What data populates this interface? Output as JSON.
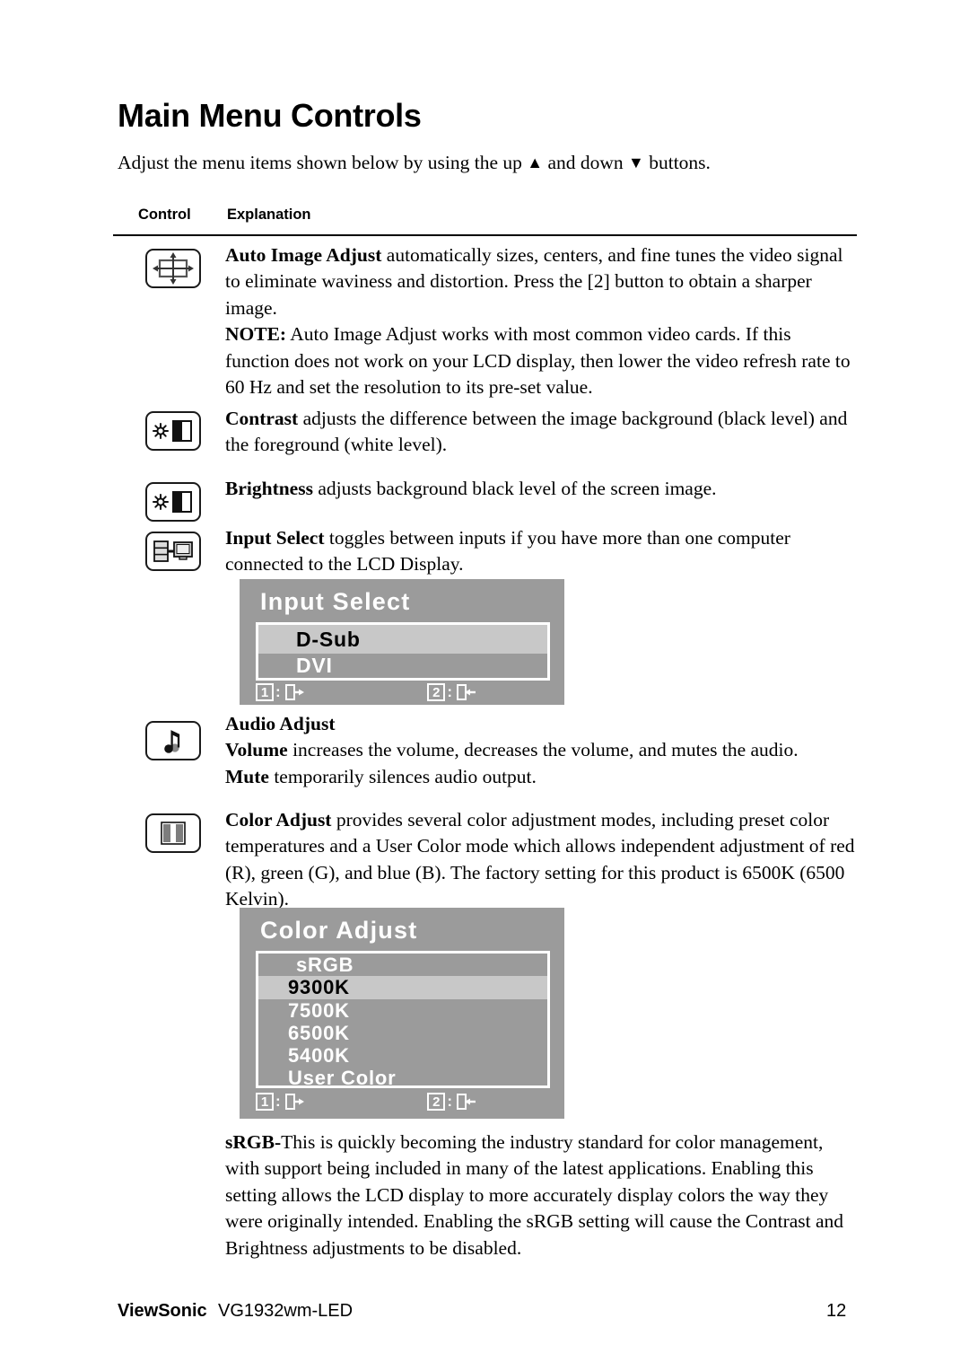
{
  "document": {
    "title": "Main Menu Controls",
    "intro_before": "Adjust the menu items shown below by using the up ",
    "intro_up_arrow": "▲",
    "intro_middle": " and down ",
    "intro_down_arrow": "▼",
    "intro_after": " buttons.",
    "columns": {
      "control": "Control",
      "explanation": "Explanation"
    }
  },
  "rows": [
    {
      "icon": "auto-image-adjust-icon",
      "term": "Auto Image Adjust",
      "text": " automatically sizes, centers, and fine tunes the video signal to eliminate waviness and distortion. Press the [2] button to obtain a sharper image.",
      "note_term": "NOTE:",
      "note_text": " Auto Image Adjust works with most common video cards. If this function does not work on your LCD display, then lower the video refresh rate to 60 Hz and set the resolution to its pre-set value."
    },
    {
      "icon": "contrast-icon",
      "term": "Contrast",
      "text": " adjusts the difference between the image background  (black level) and the foreground (white level)."
    },
    {
      "icon": "brightness-icon",
      "term": "Brightness",
      "text": " adjusts background black level of the screen image."
    },
    {
      "icon": "input-select-icon",
      "term": "Input Select",
      "text": " toggles between inputs if you have more than one computer connected to the LCD Display."
    },
    {
      "icon": "audio-adjust-icon",
      "heading": "Audio Adjust",
      "term": "Volume",
      "text": " increases the volume, decreases the volume, and mutes the audio.",
      "term2": "Mute",
      "text2": " temporarily silences audio output."
    },
    {
      "icon": "color-adjust-icon",
      "term": "Color Adjust",
      "text": " provides several color adjustment modes, including preset color temperatures and a User Color mode which allows independent adjustment of red (R), green (G), and blue (B). The factory setting for this product is 6500K (6500 Kelvin)."
    }
  ],
  "osd_input_select": {
    "title": "Input Select",
    "items": [
      {
        "label": "D-Sub",
        "selected": true
      },
      {
        "label": "DVI",
        "selected": false
      }
    ],
    "footer": {
      "key1": "1",
      "sep1": ":",
      "icon1": "exit-arrow-icon",
      "key2": "2",
      "sep2": ":",
      "icon2": "enter-arrow-icon"
    }
  },
  "osd_color_adjust": {
    "title": "Color Adjust",
    "items": [
      {
        "label": "sRGB",
        "selected": false
      },
      {
        "label": "9300K",
        "selected": true
      },
      {
        "label": "7500K",
        "selected": false
      },
      {
        "label": "6500K",
        "selected": false
      },
      {
        "label": "5400K",
        "selected": false
      },
      {
        "label": "User Color",
        "selected": false
      }
    ],
    "footer": {
      "key1": "1",
      "sep1": ":",
      "icon1": "exit-arrow-icon",
      "key2": "2",
      "sep2": ":",
      "icon2": "enter-arrow-icon"
    }
  },
  "srgb_paragraph": {
    "term": "sRGB-",
    "text": "This is quickly becoming the industry standard for color management, with support being included in many of the latest applications. Enabling this setting allows the LCD display to more accurately display colors the way they were originally intended. Enabling the sRGB setting will cause the Contrast and Brightness adjustments to be disabled."
  },
  "footer": {
    "brand": "ViewSonic",
    "model": "VG1932wm-LED",
    "page_number": "12"
  },
  "colors": {
    "osd_background": "#9b9b9b",
    "osd_selected": "#c8c8c8",
    "osd_text": "#ffffff",
    "osd_selected_text": "#000000",
    "text": "#000000",
    "page_background": "#ffffff"
  }
}
